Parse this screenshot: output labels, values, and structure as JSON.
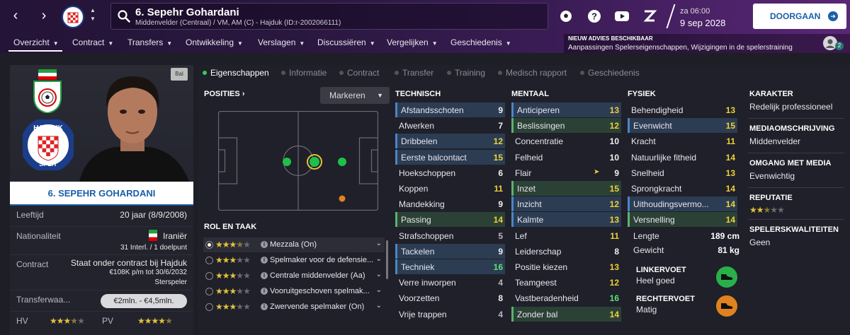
{
  "topbar": {
    "player_name": "6. Sepehr Gohardani",
    "player_sub": "Middenvelder (Centraal) / VM, AM (C) - Hajduk (ID:r-2002066111)",
    "date_label": "za 06:00",
    "date_value": "9 sep 2028",
    "continue_label": "DOORGAAN",
    "icons": [
      "back-icon",
      "forward-icon",
      "club-crest-icon",
      "search-icon",
      "football-icon",
      "help-icon",
      "video-icon",
      "z-icon",
      "arrow-right-icon"
    ]
  },
  "menu": [
    {
      "label": "Overzicht"
    },
    {
      "label": "Contract"
    },
    {
      "label": "Transfers"
    },
    {
      "label": "Ontwikkeling"
    },
    {
      "label": "Verslagen"
    },
    {
      "label": "Discussiëren"
    },
    {
      "label": "Vergelijken"
    },
    {
      "label": "Geschiedenis"
    }
  ],
  "advice": {
    "title": "NIEUW ADVIES BESCHIKBAAR",
    "text": "Aanpassingen Spelerseigenschappen, Wijzigingen in de spelerstraining",
    "count": "2"
  },
  "profile": {
    "bal_label": "Bal",
    "name_plate": "6. SEPEHR GOHARDANI",
    "age_label": "Leeftijd",
    "age_value": "20 jaar (8/9/2008)",
    "nat_label": "Nationaliteit",
    "nat_value": "Iraniër",
    "nat_sub": "31 Interl. / 1 doelpunt",
    "contract_label": "Contract",
    "contract_value": "Staat onder contract bij Hajduk",
    "contract_sub1": "€108K p/m tot 30/6/2032",
    "contract_sub2": "Sterspeler",
    "transfer_label": "Transferwaa...",
    "transfer_value": "€2mln. - €4,5mln.",
    "hv_label": "HV",
    "hv_stars": 3.5,
    "pv_label": "PV",
    "pv_stars": 4.5
  },
  "subtabs": [
    "Eigenschappen",
    "Informatie",
    "Contract",
    "Transfer",
    "Training",
    "Medisch rapport",
    "Geschiedenis"
  ],
  "positions": {
    "title": "POSITIES",
    "dropdown": "Markeren"
  },
  "roles": {
    "title": "ROL EN TAAK",
    "items": [
      {
        "name": "Mezzala (On)",
        "stars": 3.5,
        "selected": true
      },
      {
        "name": "Spelmaker voor de defensie...",
        "stars": 3,
        "selected": false
      },
      {
        "name": "Centrale middenvelder (Aa)",
        "stars": 3,
        "selected": false
      },
      {
        "name": "Vooruitgeschoven spelmak...",
        "stars": 3,
        "selected": false
      },
      {
        "name": "Zwervende spelmaker (On)",
        "stars": 3,
        "selected": false
      }
    ]
  },
  "technical": {
    "title": "TECHNISCH",
    "items": [
      {
        "name": "Afstandsschoten",
        "value": "9",
        "hl": "blue"
      },
      {
        "name": "Afwerken",
        "value": "7",
        "hl": ""
      },
      {
        "name": "Dribbelen",
        "value": "12",
        "hl": "blue"
      },
      {
        "name": "Eerste balcontact",
        "value": "15",
        "hl": "blue"
      },
      {
        "name": "Hoekschoppen",
        "value": "6",
        "hl": ""
      },
      {
        "name": "Koppen",
        "value": "11",
        "hl": ""
      },
      {
        "name": "Mandekking",
        "value": "9",
        "hl": ""
      },
      {
        "name": "Passing",
        "value": "14",
        "hl": "green"
      },
      {
        "name": "Strafschoppen",
        "value": "5",
        "hl": ""
      },
      {
        "name": "Tackelen",
        "value": "9",
        "hl": "blue"
      },
      {
        "name": "Techniek",
        "value": "16",
        "hl": "blue"
      },
      {
        "name": "Verre inworpen",
        "value": "4",
        "hl": ""
      },
      {
        "name": "Voorzetten",
        "value": "8",
        "hl": ""
      },
      {
        "name": "Vrije trappen",
        "value": "4",
        "hl": ""
      }
    ]
  },
  "mental": {
    "title": "MENTAAL",
    "items": [
      {
        "name": "Anticiperen",
        "value": "13",
        "hl": "blue"
      },
      {
        "name": "Beslissingen",
        "value": "12",
        "hl": "green"
      },
      {
        "name": "Concentratie",
        "value": "10",
        "hl": ""
      },
      {
        "name": "Felheid",
        "value": "10",
        "hl": ""
      },
      {
        "name": "Flair",
        "value": "9",
        "hl": ""
      },
      {
        "name": "Inzet",
        "value": "15",
        "hl": "green"
      },
      {
        "name": "Inzicht",
        "value": "12",
        "hl": "blue"
      },
      {
        "name": "Kalmte",
        "value": "13",
        "hl": "blue"
      },
      {
        "name": "Lef",
        "value": "11",
        "hl": ""
      },
      {
        "name": "Leiderschap",
        "value": "8",
        "hl": ""
      },
      {
        "name": "Positie kiezen",
        "value": "13",
        "hl": ""
      },
      {
        "name": "Teamgeest",
        "value": "12",
        "hl": ""
      },
      {
        "name": "Vastberadenheid",
        "value": "16",
        "hl": ""
      },
      {
        "name": "Zonder bal",
        "value": "14",
        "hl": "green"
      }
    ]
  },
  "physical": {
    "title": "FYSIEK",
    "items": [
      {
        "name": "Behendigheid",
        "value": "13",
        "hl": ""
      },
      {
        "name": "Evenwicht",
        "value": "15",
        "hl": "blue"
      },
      {
        "name": "Kracht",
        "value": "11",
        "hl": ""
      },
      {
        "name": "Natuurlijke fitheid",
        "value": "14",
        "hl": ""
      },
      {
        "name": "Snelheid",
        "value": "13",
        "hl": ""
      },
      {
        "name": "Sprongkracht",
        "value": "14",
        "hl": ""
      },
      {
        "name": "Uithoudingsvermo...",
        "value": "14",
        "hl": "blue"
      },
      {
        "name": "Versnelling",
        "value": "14",
        "hl": "green"
      }
    ],
    "length_label": "Lengte",
    "length_value": "189 cm",
    "weight_label": "Gewicht",
    "weight_value": "81 kg",
    "left_foot_label": "LINKERVOET",
    "left_foot_value": "Heel goed",
    "right_foot_label": "RECHTERVOET",
    "right_foot_value": "Matig"
  },
  "right": {
    "character_title": "KARAKTER",
    "character_value": "Redelijk professioneel",
    "media_title": "MEDIAOMSCHRIJVING",
    "media_value": "Middenvelder",
    "media_handling_title": "OMGANG MET MEDIA",
    "media_handling_value": "Evenwichtig",
    "reputation_title": "REPUTATIE",
    "reputation_stars": 2.5,
    "qualities_title": "SPELERSKWALITEITEN",
    "qualities_value": "Geen"
  },
  "colors": {
    "accent_blue": "#1b5fa8",
    "attr_green": "#5fe07a",
    "attr_yellow": "#ecd23a",
    "highlight_blue": "#4a86c8",
    "highlight_green": "#5bb36b",
    "foot_good": "#29b04a",
    "foot_weak": "#e0821f"
  }
}
